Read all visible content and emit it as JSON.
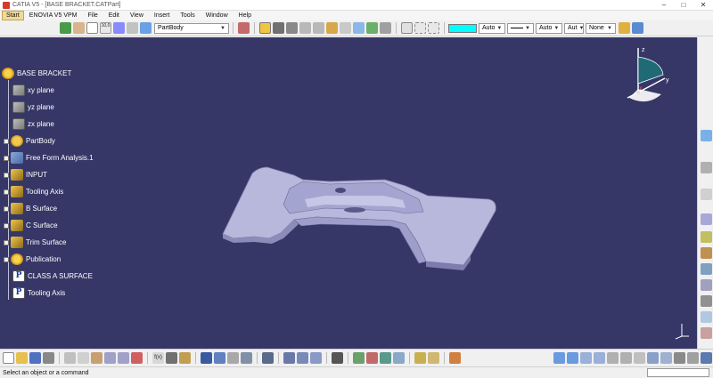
{
  "window": {
    "title": "CATIA V5 - [BASE BRACKET.CATPart]",
    "minimize": "–",
    "maximize": "□",
    "close": "✕"
  },
  "menu": [
    "Start",
    "ENOVIA V5 VPM",
    "File",
    "Edit",
    "View",
    "Insert",
    "Tools",
    "Window",
    "Help"
  ],
  "toolbar": {
    "body_dropdown": "PartBody",
    "color": "#00ffff",
    "transparency_dropdown": "Auto",
    "linetype_dropdown": "Auto",
    "thickness_dropdown": "Aut",
    "layer_dropdown": "None",
    "zoom_icon_label": "10,0"
  },
  "tree": {
    "root": "BASE BRACKET",
    "nodes": [
      {
        "label": "xy plane",
        "icon": "plane-icon"
      },
      {
        "label": "yz plane",
        "icon": "plane-icon"
      },
      {
        "label": "zx plane",
        "icon": "plane-icon"
      },
      {
        "label": "PartBody",
        "icon": "body-icon"
      },
      {
        "label": "Free Form Analysis.1",
        "icon": "analysis-icon"
      },
      {
        "label": "INPUT",
        "icon": "geometrical-set-icon"
      },
      {
        "label": "Tooling Axis",
        "icon": "geometrical-set-icon"
      },
      {
        "label": "B Surface",
        "icon": "geometrical-set-icon"
      },
      {
        "label": "C Surface",
        "icon": "geometrical-set-icon"
      },
      {
        "label": "Trim Surface",
        "icon": "geometrical-set-icon"
      },
      {
        "label": "Publication",
        "icon": "publication-icon"
      },
      {
        "label": "CLASS A SURFACE",
        "icon": "published-element-icon"
      },
      {
        "label": "Tooling Axis",
        "icon": "published-element-icon"
      }
    ]
  },
  "compass": {
    "x": "x",
    "y": "y",
    "z": "z"
  },
  "viewport_colors": {
    "background": "#363767",
    "part": "#b9b9dc"
  },
  "status": {
    "message": "Select an object or a command"
  }
}
